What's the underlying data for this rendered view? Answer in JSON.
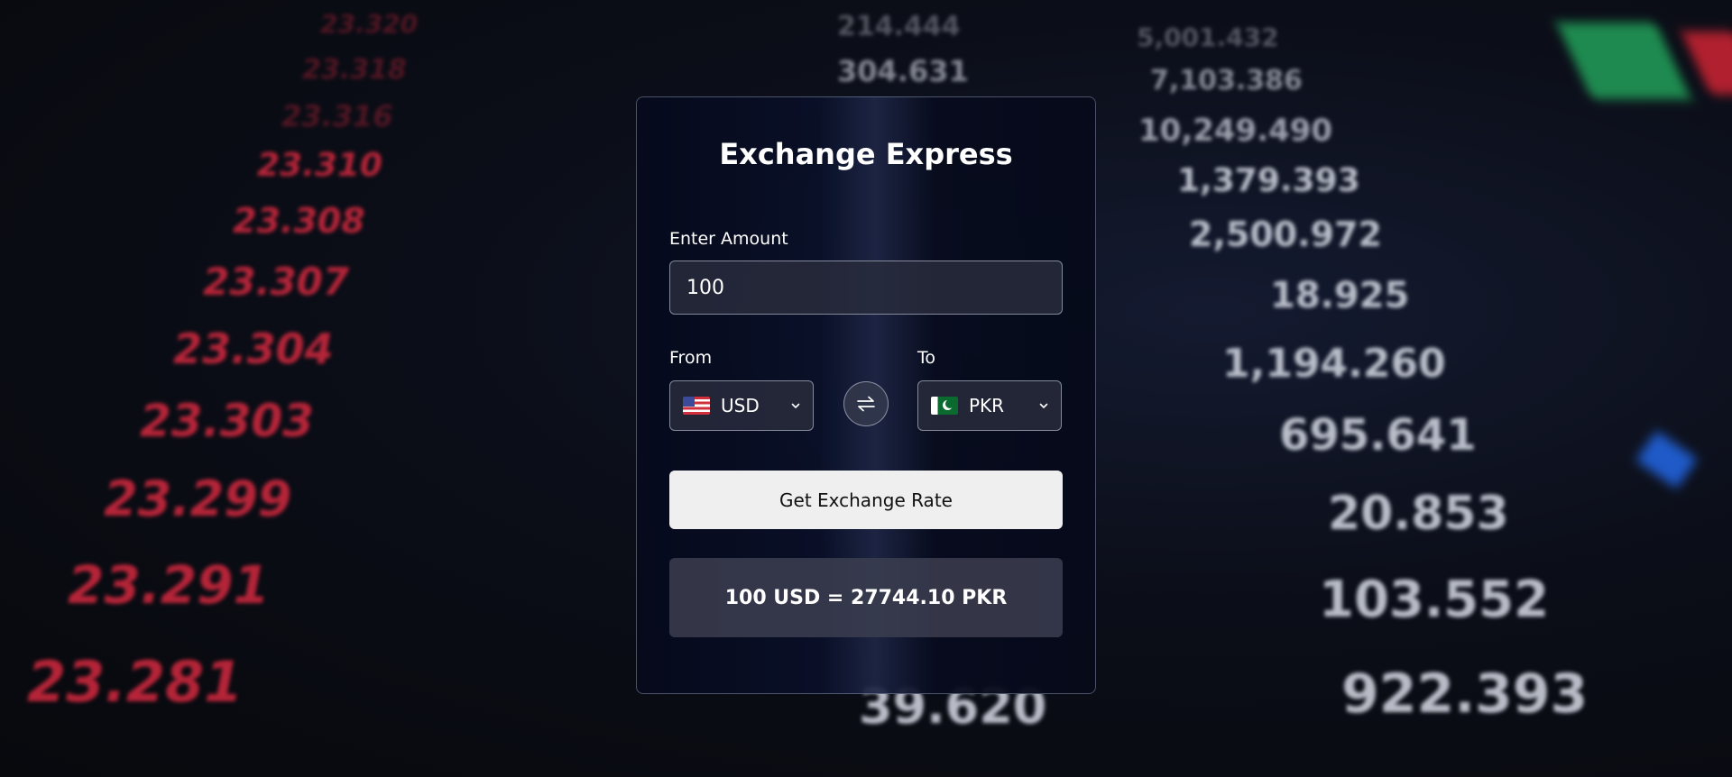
{
  "app": {
    "title": "Exchange Express"
  },
  "amount": {
    "label": "Enter Amount",
    "value": "100"
  },
  "from": {
    "label": "From",
    "currency": "USD",
    "flag": "us-flag-icon"
  },
  "to": {
    "label": "To",
    "currency": "PKR",
    "flag": "pk-flag-icon"
  },
  "swap": {
    "icon": "swap-arrows-icon"
  },
  "action": {
    "button_label": "Get Exchange Rate"
  },
  "result": {
    "text": "100 USD = 27744.10 PKR"
  },
  "background": {
    "red_numbers": [
      "23.310",
      "23.308",
      "23.307",
      "23.304",
      "23.303",
      "23.299",
      "23.291",
      "23.281"
    ],
    "white_numbers": [
      "214.444",
      "304.631",
      "7,103.386",
      "10,249.490",
      "1,379.393",
      "2,500.972",
      "18.925",
      "1,194.260",
      "695.641",
      "20.853",
      "103.552",
      "922.393",
      "39.620"
    ]
  },
  "colors": {
    "accent_red": "#d3293f",
    "button_bg": "#efefef",
    "card_border": "#a0aac8"
  }
}
